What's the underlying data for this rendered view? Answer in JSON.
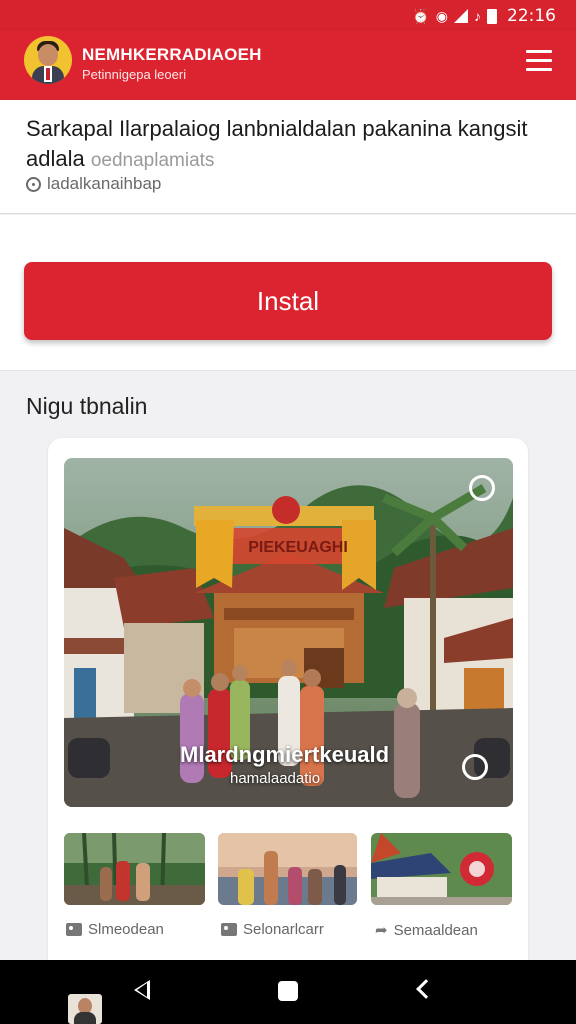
{
  "status_bar": {
    "time": "22:16",
    "icons": [
      "alarm-icon",
      "wifi-icon",
      "signal-icon",
      "note-icon",
      "battery-icon"
    ]
  },
  "app": {
    "title": "NEMHKERRADIAOEH",
    "subtitle": "Petinnigepa leoeri",
    "brand_color": "#dc2430"
  },
  "article": {
    "title": "Sarkapal Ilarpalaiog lanbnialdalan pakanina kangsit adlala",
    "title_dim": "oednaplamiats",
    "meta": "ladalkanaihbap"
  },
  "install": {
    "label": "Instal"
  },
  "gallery": {
    "heading": "Nigu tbnalin",
    "featured": {
      "banner_text": "PIEKEUAGHI",
      "caption": "Mlardngmiertkeuald",
      "sub_caption": "hamalaadatio"
    },
    "thumbnails": [
      {
        "label": "Slmeodean",
        "icon": "tag-icon"
      },
      {
        "label": "Selonarlcarr",
        "icon": "tag-icon"
      },
      {
        "label": "Semaaldean",
        "icon": "share-arrow-icon"
      }
    ]
  },
  "nav": {
    "icons": [
      "back-icon",
      "home-icon",
      "recents-icon"
    ]
  }
}
